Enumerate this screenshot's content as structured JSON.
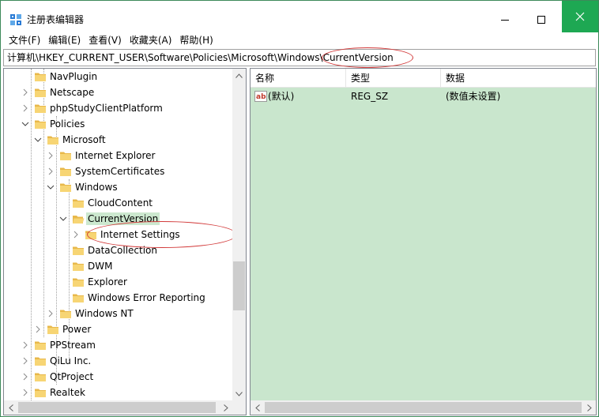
{
  "window": {
    "title": "注册表编辑器",
    "colors": {
      "accent": "#1ea853",
      "list_background": "#c9e6cd",
      "annotation": "#d23a3a"
    }
  },
  "menu": [
    "文件(F)",
    "编辑(E)",
    "查看(V)",
    "收藏夹(A)",
    "帮助(H)"
  ],
  "address": {
    "path": "计算机\\HKEY_CURRENT_USER\\Software\\Policies\\Microsoft\\Windows\\CurrentVersion"
  },
  "tree": [
    {
      "label": "NavPlugin",
      "level": 2,
      "expander": "none",
      "icon": "folder-icon"
    },
    {
      "label": "Netscape",
      "level": 2,
      "expander": "collapsed",
      "icon": "folder-icon"
    },
    {
      "label": "phpStudyClientPlatform",
      "level": 2,
      "expander": "collapsed",
      "icon": "folder-icon"
    },
    {
      "label": "Policies",
      "level": 2,
      "expander": "expanded",
      "icon": "folder-icon"
    },
    {
      "label": "Microsoft",
      "level": 3,
      "expander": "expanded",
      "icon": "folder-icon"
    },
    {
      "label": "Internet Explorer",
      "level": 4,
      "expander": "collapsed",
      "icon": "folder-icon"
    },
    {
      "label": "SystemCertificates",
      "level": 4,
      "expander": "collapsed",
      "icon": "folder-icon"
    },
    {
      "label": "Windows",
      "level": 4,
      "expander": "expanded",
      "icon": "folder-icon"
    },
    {
      "label": "CloudContent",
      "level": 5,
      "expander": "none",
      "icon": "folder-icon"
    },
    {
      "label": "CurrentVersion",
      "level": 5,
      "expander": "expanded",
      "icon": "folder-open-icon",
      "selected": true
    },
    {
      "label": "Internet Settings",
      "level": 6,
      "expander": "collapsed",
      "icon": "folder-icon"
    },
    {
      "label": "DataCollection",
      "level": 5,
      "expander": "none",
      "icon": "folder-icon"
    },
    {
      "label": "DWM",
      "level": 5,
      "expander": "none",
      "icon": "folder-icon"
    },
    {
      "label": "Explorer",
      "level": 5,
      "expander": "none",
      "icon": "folder-icon"
    },
    {
      "label": "Windows Error Reporting",
      "level": 5,
      "expander": "none",
      "icon": "folder-icon"
    },
    {
      "label": "Windows NT",
      "level": 4,
      "expander": "collapsed",
      "icon": "folder-icon"
    },
    {
      "label": "Power",
      "level": 3,
      "expander": "collapsed",
      "icon": "folder-icon"
    },
    {
      "label": "PPStream",
      "level": 2,
      "expander": "collapsed",
      "icon": "folder-icon"
    },
    {
      "label": "QiLu Inc.",
      "level": 2,
      "expander": "collapsed",
      "icon": "folder-icon"
    },
    {
      "label": "QtProject",
      "level": 2,
      "expander": "collapsed",
      "icon": "folder-icon"
    },
    {
      "label": "Realtek",
      "level": 2,
      "expander": "collapsed",
      "icon": "folder-icon"
    }
  ],
  "list": {
    "columns": [
      "名称",
      "类型",
      "数据"
    ],
    "rows": [
      {
        "name": "(默认)",
        "type": "REG_SZ",
        "data": "(数值未设置)",
        "icon": "string-value-icon"
      }
    ]
  }
}
